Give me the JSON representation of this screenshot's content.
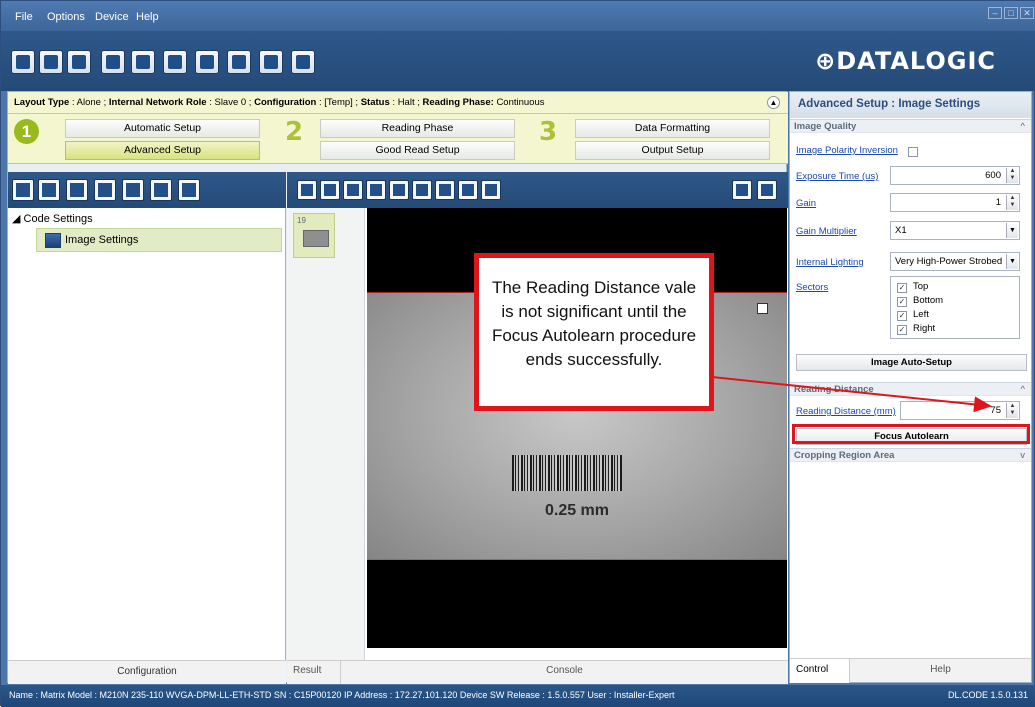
{
  "menu": [
    "File",
    "Options",
    "Device",
    "Help"
  ],
  "window_controls": [
    "–",
    "□",
    "✕"
  ],
  "logo": "DATALOGIC",
  "layout_bar": {
    "layout_type_label": "Layout Type",
    "layout_type_value": "Alone",
    "network_role_label": "Internal Network Role",
    "network_role_value": "Slave 0",
    "configuration_label": "Configuration",
    "configuration_value": "[Temp]",
    "status_label": "Status",
    "status_value": "Halt",
    "reading_phase_label": "Reading Phase:",
    "reading_phase_value": "Continuous"
  },
  "steps": {
    "step1": "1",
    "step2": "2",
    "step3": "3",
    "automatic_setup": "Automatic Setup",
    "advanced_setup": "Advanced Setup",
    "reading_phase": "Reading Phase",
    "good_read_setup": "Good Read Setup",
    "data_formatting": "Data Formatting",
    "output_setup": "Output Setup"
  },
  "tree": {
    "root": "◢ Code Settings",
    "selected": "Image Settings"
  },
  "left_footer": "Configuration",
  "viewer": {
    "thumb_number": "19",
    "barcode_label": "0.25 mm",
    "tab_result": "Result",
    "tab_console": "Console"
  },
  "right": {
    "title": "Advanced Setup : Image Settings",
    "image_quality": "Image Quality",
    "image_polarity_inversion": "Image Polarity Inversion",
    "exposure_time_label": "Exposure Time (us)",
    "exposure_time_value": "600",
    "gain_label": "Gain",
    "gain_value": "1",
    "gain_multiplier_label": "Gain Multiplier",
    "gain_multiplier_value": "X1",
    "internal_lighting_label": "Internal Lighting",
    "internal_lighting_value": "Very High-Power Strobed",
    "sectors_label": "Sectors",
    "sectors": [
      "Top",
      "Bottom",
      "Left",
      "Right"
    ],
    "image_auto_setup": "Image Auto-Setup",
    "reading_distance_section": "Reading Distance",
    "reading_distance_label": "Reading Distance (mm)",
    "reading_distance_value": "75",
    "focus_autolearn": "Focus Autolearn",
    "cropping_region_area": "Cropping Region Area",
    "tab_control": "Control",
    "tab_help": "Help"
  },
  "status_bar": {
    "text": "Name : Matrix  Model : M210N 235-110 WVGA-DPM-LL-ETH-STD  SN : C15P00120  IP Address : 172.27.101.120  Device SW Release : 1.5.0.557  User : Installer-Expert",
    "version": "DL.CODE 1.5.0.131"
  },
  "callout": "The Reading Distance vale is not significant until the Focus Autolearn procedure ends successfully.",
  "colors": {
    "accent_green": "#99ba1f",
    "toolbar_blue": "#244a77",
    "annotation_red": "#e0141c"
  }
}
